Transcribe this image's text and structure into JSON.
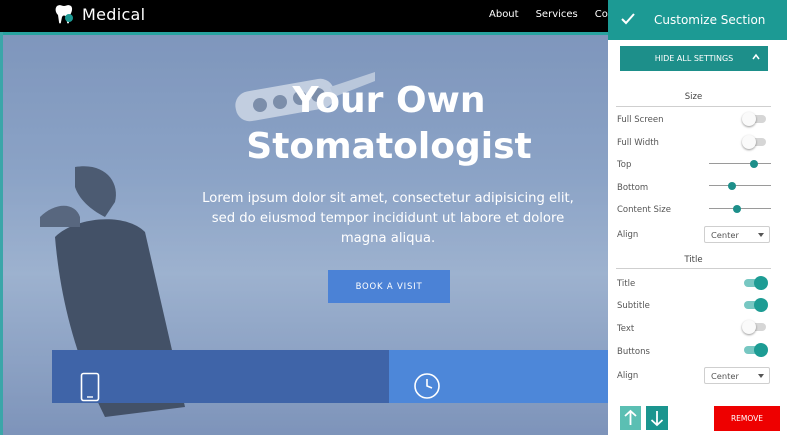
{
  "brand": {
    "name": "Medical",
    "logo_icon": "tooth-logo-icon"
  },
  "nav": {
    "links": [
      "About",
      "Services",
      "Co"
    ]
  },
  "hero": {
    "title_line1": "Your Own",
    "title_line2": "Stomatologist",
    "subtitle_line1": "Lorem ipsum dolor sit amet, consectetur adipisicing elit,",
    "subtitle_line2": "sed do eiusmod tempor incididunt ut labore et dolore",
    "subtitle_line3": "magna aliqua.",
    "button_label": "BOOK A VISIT"
  },
  "cards": [
    {
      "icon": "phone-icon"
    },
    {
      "icon": "clock-icon"
    }
  ],
  "panel": {
    "title": "Customize Section",
    "hide_all_label": "HIDE ALL SETTINGS",
    "size_section": "Size",
    "title_section": "Title",
    "rows": {
      "full_screen": {
        "label": "Full Screen",
        "on": false
      },
      "full_width": {
        "label": "Full Width",
        "on": false
      },
      "top": {
        "label": "Top",
        "value": 0.75
      },
      "bottom": {
        "label": "Bottom",
        "value": 0.35
      },
      "content_size": {
        "label": "Content Size",
        "value": 0.45
      },
      "align_size": {
        "label": "Align",
        "selected": "Center"
      },
      "title": {
        "label": "Title",
        "on": true
      },
      "subtitle": {
        "label": "Subtitle",
        "on": true
      },
      "text": {
        "label": "Text",
        "on": false
      },
      "buttons": {
        "label": "Buttons",
        "on": true
      },
      "align_title": {
        "label": "Align",
        "selected": "Center"
      }
    },
    "remove_label": "REMOVE"
  },
  "colors": {
    "panel_accent": "#1c9a94",
    "remove_red": "#ee0000",
    "book_button": "#4b82d6"
  }
}
